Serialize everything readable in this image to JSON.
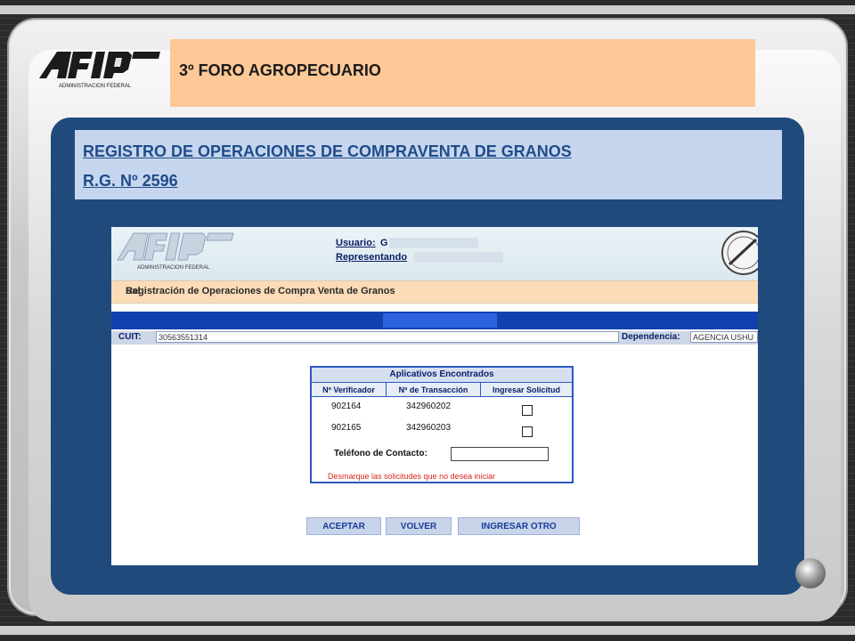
{
  "slide": {
    "title": "3º FORO AGROPECUARIO",
    "heading_line1": "REGISTRO DE OPERACIONES DE COMPRAVENTA DE GRANOS",
    "heading_line2": "R.G. Nº 2596",
    "logo_text": "AFIP",
    "logo_subtext": "ADMINISTRACION FEDERAL"
  },
  "app": {
    "logo_text": "AFIP",
    "logo_subtext": "ADMINISTRACION FEDERAL",
    "user_label": "Usuario:",
    "user_value": "G",
    "representing_label": "Representando",
    "section_title": "Registración de Operaciones de Compra Venta de Granos",
    "exit_label": "Sal",
    "cuit_label": "CUIT:",
    "cuit_value": "30563551314",
    "dependency_label": "Dependencia:",
    "dependency_value": "AGENCIA USHU",
    "table": {
      "title": "Aplicativos Encontrados",
      "columns": [
        "Nº Verificador",
        "Nº de Transacción",
        "Ingresar Solicitud"
      ],
      "rows": [
        {
          "verificador": "902164",
          "transaccion": "342960202"
        },
        {
          "verificador": "902165",
          "transaccion": "342960203"
        }
      ],
      "phone_label": "Teléfono de Contacto:",
      "phone_value": "",
      "warning": "Desmarque las solicitudes que no desea iniciar"
    },
    "buttons": {
      "accept": "ACEPTAR",
      "back": "VOLVER",
      "another": "INGRESAR OTRO"
    }
  }
}
